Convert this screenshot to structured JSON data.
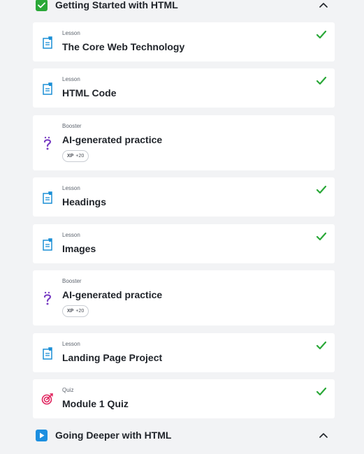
{
  "modules": [
    {
      "title": "Getting Started with HTML",
      "status_icon": "check-badge-icon",
      "color": "#2aa838",
      "expanded": true
    },
    {
      "title": "Going Deeper with HTML",
      "status_icon": "play-badge-icon",
      "color": "#1d8fe0",
      "expanded": true
    }
  ],
  "items": [
    {
      "kind": "Lesson",
      "title": "The Core Web Technology",
      "icon": "lesson-icon",
      "completed": true
    },
    {
      "kind": "Lesson",
      "title": "HTML Code",
      "icon": "lesson-icon",
      "completed": true
    },
    {
      "kind": "Booster",
      "title": "AI-generated practice",
      "icon": "question-icon",
      "completed": false,
      "xp_label": "XP",
      "xp_value": "+20"
    },
    {
      "kind": "Lesson",
      "title": "Headings",
      "icon": "lesson-icon",
      "completed": true
    },
    {
      "kind": "Lesson",
      "title": "Images",
      "icon": "lesson-icon",
      "completed": true
    },
    {
      "kind": "Booster",
      "title": "AI-generated practice",
      "icon": "question-icon",
      "completed": false,
      "xp_label": "XP",
      "xp_value": "+20"
    },
    {
      "kind": "Lesson",
      "title": "Landing Page Project",
      "icon": "lesson-icon",
      "completed": true
    },
    {
      "kind": "Quiz",
      "title": "Module 1 Quiz",
      "icon": "target-icon",
      "completed": true
    }
  ],
  "colors": {
    "lesson": "#1b8fd6",
    "booster": "#7a3fc4",
    "quiz": "#e0245e",
    "check": "#2aa838"
  }
}
